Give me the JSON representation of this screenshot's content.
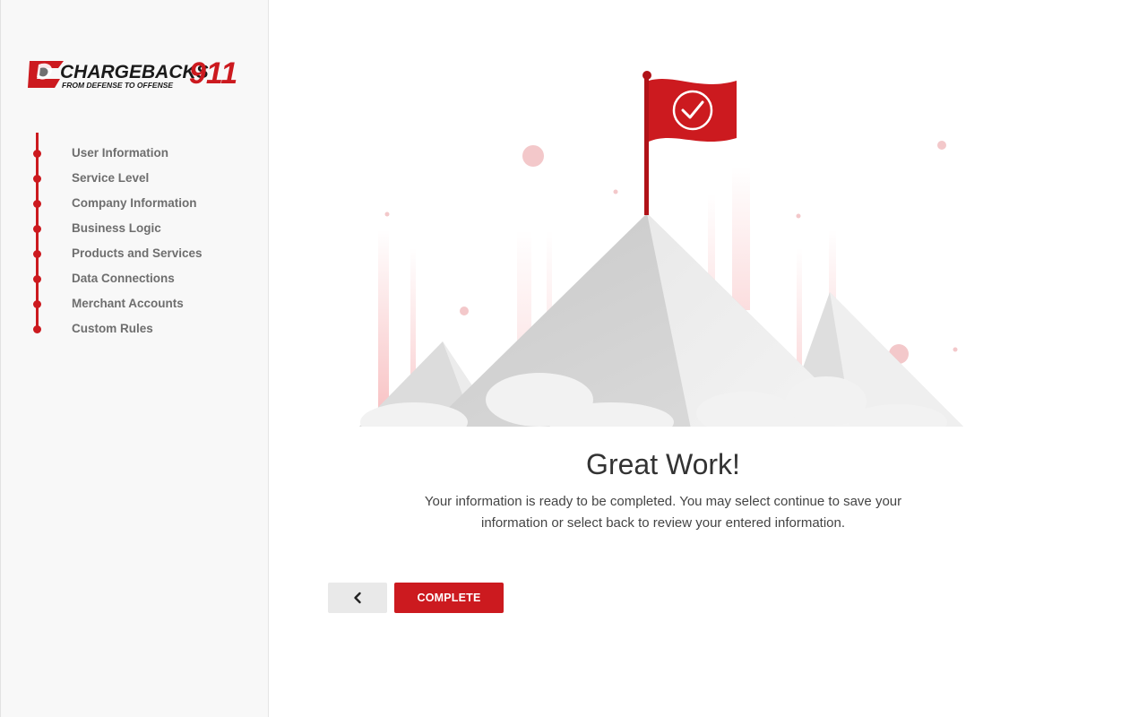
{
  "brand": {
    "logo_text": "CHARGEBACKS",
    "logo_number": "911",
    "tagline": "FROM DEFENSE TO OFFENSE",
    "accent_color": "#cc1a1f"
  },
  "sidebar": {
    "steps": [
      {
        "label": "User Information"
      },
      {
        "label": "Service Level"
      },
      {
        "label": "Company Information"
      },
      {
        "label": "Business Logic"
      },
      {
        "label": "Products and Services"
      },
      {
        "label": "Data Connections"
      },
      {
        "label": "Merchant Accounts"
      },
      {
        "label": "Custom Rules"
      }
    ]
  },
  "main": {
    "headline": "Great Work!",
    "message": "Your information is ready to be completed. You may select continue to save your information or select back to review your entered information.",
    "back_icon": "chevron-left-icon",
    "complete_label": "COMPLETE",
    "flag_icon": "checkmark-icon"
  }
}
